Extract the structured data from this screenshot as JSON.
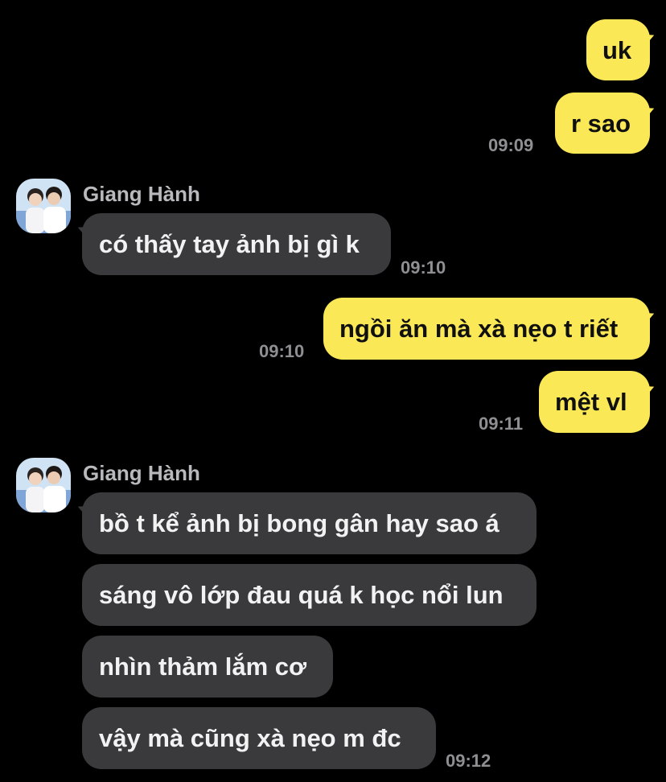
{
  "conversation": {
    "sender_name": "Giang Hành",
    "messages": [
      {
        "text": "uk",
        "direction": "sent"
      },
      {
        "text": "r sao",
        "direction": "sent",
        "time": "09:09"
      },
      {
        "text": "có thấy tay ảnh bị gì k",
        "direction": "received",
        "time": "09:10"
      },
      {
        "text": "ngồi ăn mà xà nẹo t riết",
        "direction": "sent",
        "time": "09:10"
      },
      {
        "text": "mệt vl",
        "direction": "sent",
        "time": "09:11"
      },
      {
        "text": "bồ t kể ảnh bị bong gân hay sao á",
        "direction": "received"
      },
      {
        "text": "sáng vô lớp đau quá k học nổi lun",
        "direction": "received"
      },
      {
        "text": "nhìn thảm lắm cơ",
        "direction": "received"
      },
      {
        "text": "vậy mà cũng xà nẹo m đc",
        "direction": "received",
        "time": "09:12"
      }
    ]
  },
  "colors": {
    "background": "#000000",
    "sent_bubble": "#fae856",
    "received_bubble": "#3a3a3d",
    "timestamp": "#8e8e93"
  },
  "icons": {
    "avatar": "profile-photo-avatar"
  }
}
